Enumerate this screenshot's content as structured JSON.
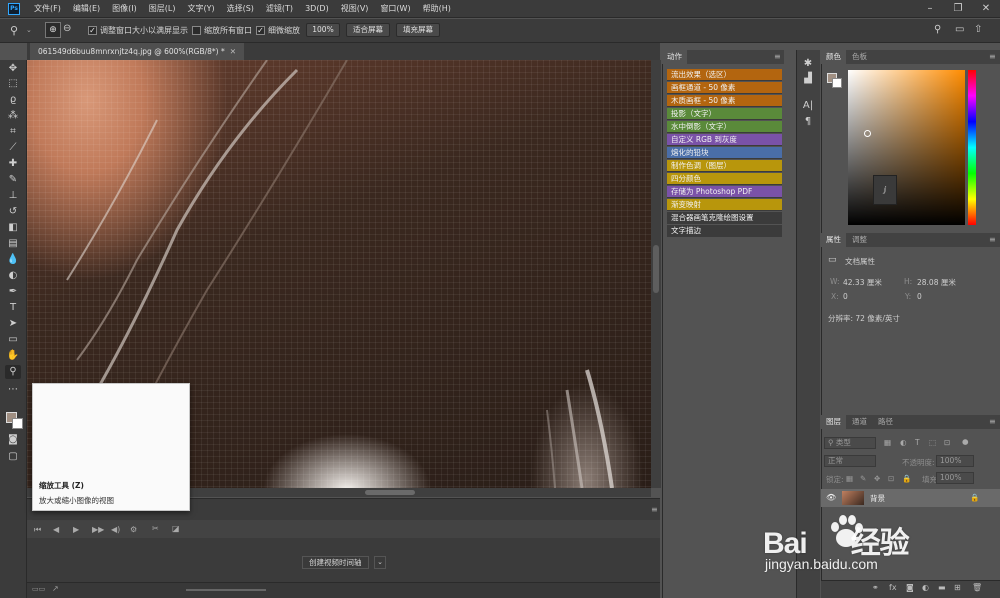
{
  "app": {
    "logo": "Ps"
  },
  "menu": [
    "文件(F)",
    "编辑(E)",
    "图像(I)",
    "图层(L)",
    "文字(Y)",
    "选择(S)",
    "滤镜(T)",
    "3D(D)",
    "视图(V)",
    "窗口(W)",
    "帮助(H)"
  ],
  "options": {
    "resize_windows": "调整窗口大小以满屏显示",
    "zoom_all": "缩放所有窗口",
    "scrubby_zoom": "细微缩放",
    "zoom_pct": "100%",
    "fit_screen": "适合屏幕",
    "fill_screen": "填充屏幕"
  },
  "document": {
    "tab": "061549d6buu8mnrxnjtz4q.jpg @ 600%(RGB/8*) *"
  },
  "tooltip": {
    "title": "缩放工具 (Z)",
    "desc": "放大或缩小图像的视图"
  },
  "timeline": {
    "create_button": "创建视频时间轴"
  },
  "actions_panel": {
    "tab": "动作",
    "items": [
      {
        "label": "流出效果（选区）",
        "color": "#b3650f"
      },
      {
        "label": "画框通道 - 50 像素",
        "color": "#b3650f"
      },
      {
        "label": "木质画框 - 50 像素",
        "color": "#b3650f"
      },
      {
        "label": "投影（文字）",
        "color": "#5a8a3a"
      },
      {
        "label": "水中倒影（文字）",
        "color": "#5a8a3a"
      },
      {
        "label": "自定义 RGB 到灰度",
        "color": "#7a52a8"
      },
      {
        "label": "熔化的铅块",
        "color": "#4a6ea8"
      },
      {
        "label": "制作色调（图层）",
        "color": "#b8960c"
      },
      {
        "label": "四分颜色",
        "color": "#b8960c"
      },
      {
        "label": "存储为 Photoshop PDF",
        "color": "#7a52a8"
      },
      {
        "label": "渐变映射",
        "color": "#b8960c"
      },
      {
        "label": "混合器画笔克隆绘图设置",
        "color": "#3b3b3b"
      },
      {
        "label": "文字描边",
        "color": "#3b3b3b"
      }
    ]
  },
  "color_panel": {
    "tabs": [
      "颜色",
      "色板"
    ]
  },
  "properties_panel": {
    "tabs": [
      "属性",
      "调整"
    ],
    "title": "文档属性",
    "w_label": "W:",
    "w_value": "42.33 厘米",
    "h_label": "H:",
    "h_value": "28.08 厘米",
    "x_label": "X:",
    "x_value": "0",
    "y_label": "Y:",
    "y_value": "0",
    "resolution": "分辨率: 72 像素/英寸"
  },
  "layers_panel": {
    "tabs": [
      "图层",
      "通道",
      "路径"
    ],
    "filter": "类型",
    "blend_mode": "正常",
    "opacity_label": "不透明度:",
    "opacity_value": "100%",
    "lock_label": "锁定:",
    "fill_label": "填充:",
    "fill_value": "100%",
    "layer_name": "背景"
  },
  "watermark": {
    "brand_left": "Bai",
    "brand_right": "经验",
    "url": "jingyan.baidu.com"
  }
}
